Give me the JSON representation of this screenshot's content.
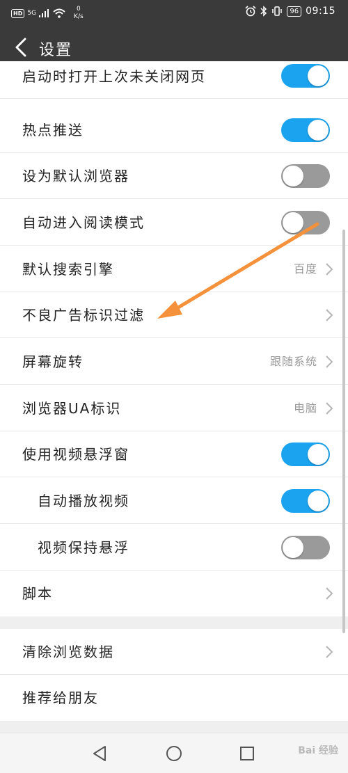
{
  "status_bar": {
    "hd": "HD",
    "network": "5G",
    "speed_value": "0",
    "speed_unit": "K/s",
    "battery": "96",
    "time": "09:15"
  },
  "header": {
    "title": "设置"
  },
  "settings": {
    "startup_restore": {
      "label": "启动时打开上次未关闭网页",
      "on": true
    },
    "hot_push": {
      "label": "热点推送",
      "on": true
    },
    "default_browser": {
      "label": "设为默认浏览器",
      "on": false
    },
    "reading_mode": {
      "label": "自动进入阅读模式",
      "on": false
    },
    "search_engine": {
      "label": "默认搜索引擎",
      "value": "百度"
    },
    "ad_filter": {
      "label": "不良广告标识过滤"
    },
    "screen_rotation": {
      "label": "屏幕旋转",
      "value": "跟随系统"
    },
    "ua": {
      "label": "浏览器UA标识",
      "value": "电脑"
    },
    "floating_video": {
      "label": "使用视频悬浮窗",
      "on": true
    },
    "autoplay_video": {
      "label": "自动播放视频",
      "on": true
    },
    "keep_floating": {
      "label": "视频保持悬浮",
      "on": false
    },
    "script": {
      "label": "脚本"
    },
    "clear_data": {
      "label": "清除浏览数据"
    },
    "recommend": {
      "label": "推荐给朋友"
    }
  },
  "watermark": "Bai 经验",
  "colors": {
    "toggle_on": "#1ba3ef",
    "toggle_off": "#9a9a9a",
    "header_bg": "#3a3a3a",
    "annotation_arrow": "#f5913a"
  },
  "icons": {
    "back": "chevron-left-icon",
    "row_arrow": "chevron-right-icon",
    "nav_back": "triangle-back-icon",
    "nav_home": "circle-home-icon",
    "nav_recent": "square-recent-icon"
  }
}
